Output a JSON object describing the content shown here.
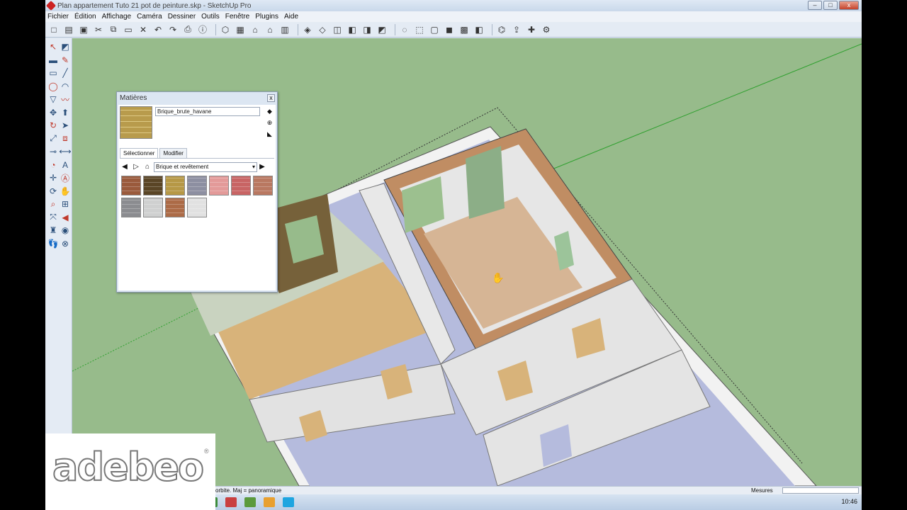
{
  "window": {
    "title": "Plan appartement Tuto 21 pot de peinture.skp - SketchUp Pro",
    "controls": {
      "minimize": "–",
      "maximize": "□",
      "close": "x"
    }
  },
  "menu": [
    "Fichier",
    "Édition",
    "Affichage",
    "Caméra",
    "Dessiner",
    "Outils",
    "Fenêtre",
    "Plugins",
    "Aide"
  ],
  "toolbar_icons": [
    "new-icon",
    "open-icon",
    "save-icon",
    "cut-icon",
    "copy-icon",
    "paste-icon",
    "erase-icon",
    "undo-icon",
    "redo-icon",
    "print-icon",
    "info-icon",
    "sep",
    "component-icon",
    "box-icon",
    "home-icon",
    "house-icon",
    "wall-icon",
    "sep",
    "iso-view-icon",
    "top-view-icon",
    "front-view-icon",
    "right-view-icon",
    "back-view-icon",
    "left-view-icon",
    "sep",
    "xray-icon",
    "wireframe-icon",
    "hidden-line-icon",
    "shaded-icon",
    "textured-icon",
    "mono-icon",
    "sep",
    "warehouse-icon",
    "share-icon",
    "extension-icon",
    "dynamic-icon"
  ],
  "materials_panel": {
    "title": "Matières",
    "close": "x",
    "material_name": "Brique_brute_havane",
    "tabs": {
      "select": "Sélectionner",
      "edit": "Modifier"
    },
    "library": "Brique et revêtement",
    "swatches": [
      "#9a5a3c",
      "#5a4526",
      "#b69846",
      "#8d8fa1",
      "#e39a99",
      "#c86464",
      "#b97861",
      "#8b8c90",
      "#cfd0d0",
      "#ac6b47",
      "#e1e1e1"
    ]
  },
  "status": {
    "hint": "orbite. Maj = panoramique",
    "measures_label": "Mesures"
  },
  "taskbar": {
    "clock": "10:46",
    "apps": [
      {
        "icon": "explorer-icon",
        "color": "#2c6fb5"
      },
      {
        "icon": "outlook-icon",
        "color": "#1e64b4"
      },
      {
        "icon": "word-icon",
        "color": "#2a5ba8"
      },
      {
        "icon": "app-icon",
        "color": "#3b8fd2"
      },
      {
        "icon": "folder-icon",
        "color": "#e1b24c"
      },
      {
        "icon": "sketchup-icon",
        "color": "#c23a2b"
      },
      {
        "icon": "paint-icon",
        "color": "#e0a23a"
      },
      {
        "icon": "media-icon",
        "color": "#3c7bbd"
      },
      {
        "icon": "chrome-icon",
        "color": "#3d8c3d"
      },
      {
        "icon": "mail-icon",
        "color": "#c94040"
      },
      {
        "icon": "browser-icon",
        "color": "#5b9a3c"
      },
      {
        "icon": "player-icon",
        "color": "#e8a030"
      },
      {
        "icon": "skype-icon",
        "color": "#1ea5e0"
      }
    ]
  },
  "logo": {
    "text": "adebeo",
    "registered": "®"
  }
}
